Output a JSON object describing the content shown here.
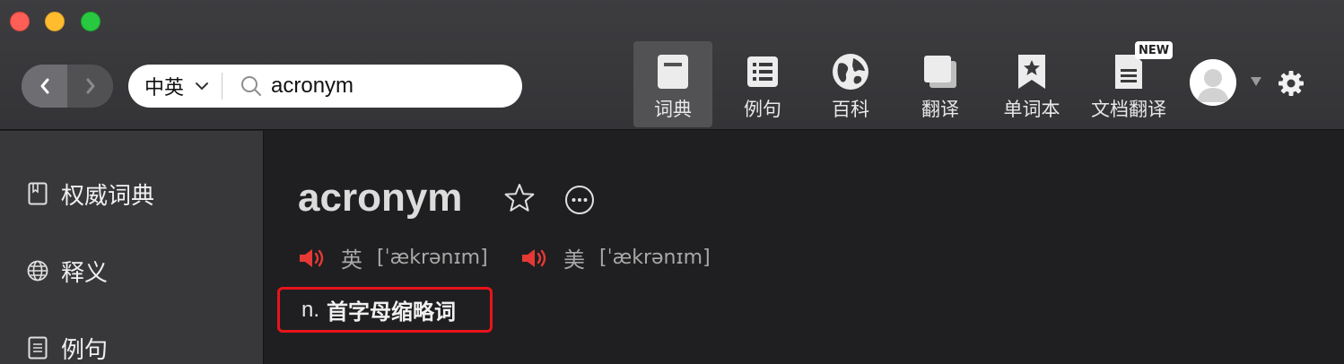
{
  "window": {
    "traffic_lights": [
      "close",
      "minimize",
      "zoom"
    ]
  },
  "search": {
    "lang": "中英",
    "query": "acronym"
  },
  "toolbar": {
    "tools": [
      {
        "id": "dict",
        "label": "词典",
        "icon": "dictionary-icon",
        "active": true
      },
      {
        "id": "examples",
        "label": "例句",
        "icon": "list-icon",
        "active": false
      },
      {
        "id": "wiki",
        "label": "百科",
        "icon": "globe-icon",
        "active": false
      },
      {
        "id": "translate",
        "label": "翻译",
        "icon": "copy-icon",
        "active": false
      },
      {
        "id": "wordbook",
        "label": "单词本",
        "icon": "bookmark-star-icon",
        "active": false
      },
      {
        "id": "doc_translate",
        "label": "文档翻译",
        "icon": "document-icon",
        "active": false
      }
    ],
    "new_badge": "NEW"
  },
  "sidebar": {
    "items": [
      {
        "label": "权威词典",
        "icon": "book-icon"
      },
      {
        "label": "释义",
        "icon": "globe-icon"
      },
      {
        "label": "例句",
        "icon": "document-icon"
      }
    ]
  },
  "entry": {
    "word": "acronym",
    "pronunciations": [
      {
        "region": "英",
        "ipa": "[ˈækrənɪm]"
      },
      {
        "region": "美",
        "ipa": "[ˈækrənɪm]"
      }
    ],
    "definition": {
      "pos": "n.",
      "text": "首字母缩略词"
    }
  },
  "colors": {
    "accent_red": "#e8141a",
    "speaker_red": "#e53935",
    "toolbar_bg": "#3a3a3d",
    "sidebar_bg": "#38383b",
    "main_bg": "#1f1f21"
  }
}
